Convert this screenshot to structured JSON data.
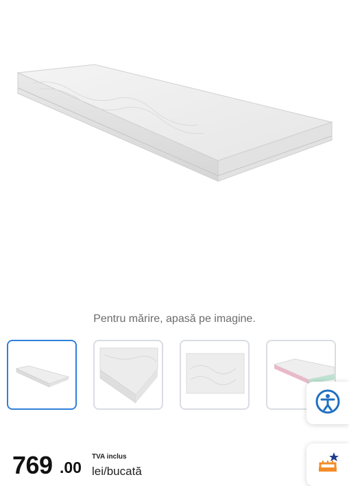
{
  "gallery": {
    "hint": "Pentru mărire, apasă pe imagine.",
    "main_image_alt": "mattress-image",
    "thumbnails": [
      {
        "name": "thumbnail-1",
        "active": true
      },
      {
        "name": "thumbnail-2",
        "active": false
      },
      {
        "name": "thumbnail-3",
        "active": false
      },
      {
        "name": "thumbnail-4",
        "active": false
      }
    ]
  },
  "price": {
    "integer": "769",
    "decimal": ".00",
    "vat_label": "TVA inclus",
    "unit": "lei/bucată"
  },
  "side_buttons": {
    "accessibility_icon": "accessibility-icon",
    "rewards_icon": "cake-star-icon"
  },
  "colors": {
    "accent": "#2f7fd8",
    "accessibility": "#1f6fbf",
    "rewards": "#f28c28"
  }
}
